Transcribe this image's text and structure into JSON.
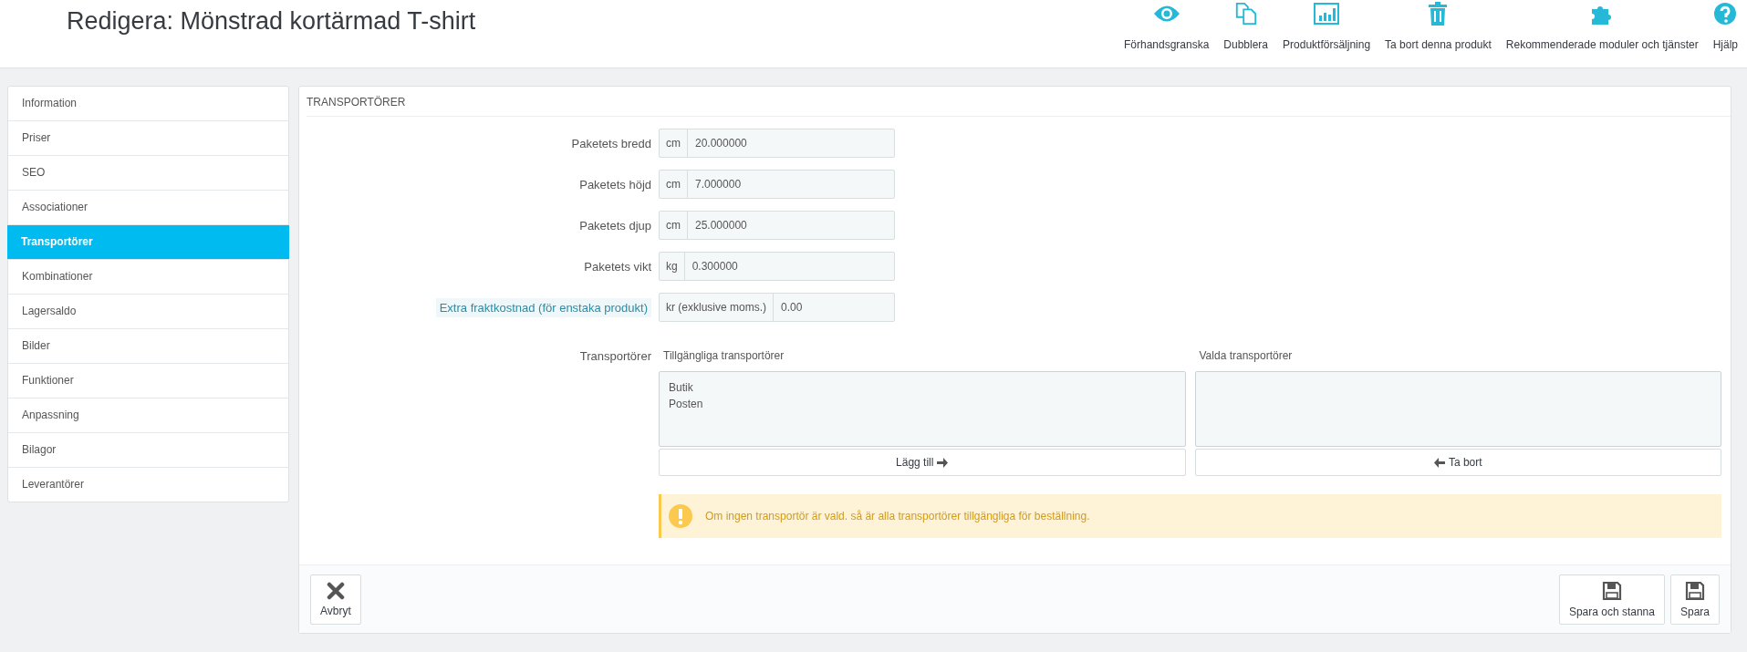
{
  "page_title": "Redigera: Mönstrad kortärmad T-shirt",
  "toolbar": [
    {
      "kind": "preview",
      "label": "Förhandsgranska"
    },
    {
      "kind": "duplicate",
      "label": "Dubblera"
    },
    {
      "kind": "sales",
      "label": "Produktförsäljning"
    },
    {
      "kind": "delete",
      "label": "Ta bort denna produkt"
    },
    {
      "kind": "modules",
      "label": "Rekommenderade moduler och tjänster"
    },
    {
      "kind": "help",
      "label": "Hjälp"
    }
  ],
  "sidebar": {
    "items": [
      {
        "label": "Information",
        "selected": false
      },
      {
        "label": "Priser",
        "selected": false
      },
      {
        "label": "SEO",
        "selected": false
      },
      {
        "label": "Associationer",
        "selected": false
      },
      {
        "label": "Transportörer",
        "selected": true
      },
      {
        "label": "Kombinationer",
        "selected": false
      },
      {
        "label": "Lagersaldo",
        "selected": false
      },
      {
        "label": "Bilder",
        "selected": false
      },
      {
        "label": "Funktioner",
        "selected": false
      },
      {
        "label": "Anpassning",
        "selected": false
      },
      {
        "label": "Bilagor",
        "selected": false
      },
      {
        "label": "Leverantörer",
        "selected": false
      }
    ]
  },
  "panel": {
    "heading": "TRANSPORTÖRER",
    "fields": [
      {
        "label": "Paketets bredd",
        "unit": "cm",
        "value": "20.000000",
        "hint": false
      },
      {
        "label": "Paketets höjd",
        "unit": "cm",
        "value": "7.000000",
        "hint": false
      },
      {
        "label": "Paketets djup",
        "unit": "cm",
        "value": "25.000000",
        "hint": false
      },
      {
        "label": "Paketets vikt",
        "unit": "kg",
        "value": "0.300000",
        "hint": false
      },
      {
        "label": "Extra fraktkostnad (för enstaka produkt)",
        "unit": "kr (exklusive moms.)",
        "value": "0.00",
        "hint": true
      }
    ],
    "carriers": {
      "label": "Transportörer",
      "available": {
        "title": "Tillgängliga transportörer",
        "items": [
          "Butik",
          "Posten"
        ],
        "button": "Lägg till"
      },
      "selected": {
        "title": "Valda transportörer",
        "button": "Ta bort"
      }
    },
    "alert": "Om ingen transportör är vald. så är alla transportörer tillgängliga för beställning."
  },
  "footer": {
    "left": [
      {
        "kind": "cancel",
        "label": "Avbryt"
      }
    ],
    "right": [
      {
        "kind": "save",
        "label": "Spara och stanna"
      },
      {
        "kind": "save",
        "label": "Spara"
      }
    ]
  }
}
